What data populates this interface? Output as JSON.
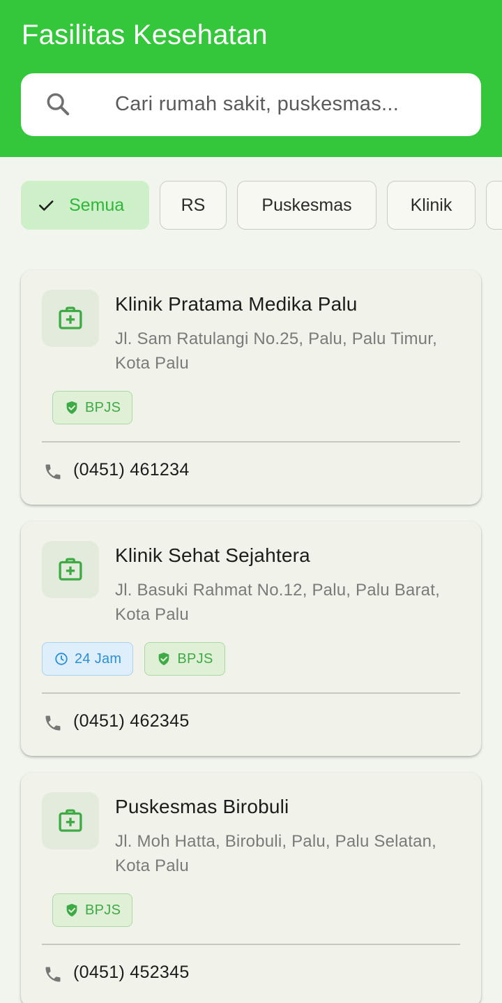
{
  "header": {
    "title": "Fasilitas Kesehatan",
    "search_placeholder": "Cari rumah sakit, puskesmas...",
    "search_value": ""
  },
  "filters": [
    {
      "label": "Semua",
      "active": true
    },
    {
      "label": "RS",
      "active": false
    },
    {
      "label": "Puskesmas",
      "active": false
    },
    {
      "label": "Klinik",
      "active": false
    }
  ],
  "facilities": [
    {
      "name": "Klinik Pratama Medika Palu",
      "address_line1": "Jl. Sam Ratulangi No.25, Palu, Palu Timur,",
      "address_line2": "Kota Palu",
      "badges": [
        "BPJS"
      ],
      "phone": "(0451) 461234"
    },
    {
      "name": "Klinik Sehat Sejahtera",
      "address_line1": "Jl. Basuki Rahmat No.12, Palu, Palu Barat,",
      "address_line2": "Kota Palu",
      "badges": [
        "24 Jam",
        "BPJS"
      ],
      "phone": "(0451) 462345"
    },
    {
      "name": "Puskesmas Birobuli",
      "address_line1": "Jl. Moh Hatta, Birobuli, Palu, Palu Selatan,",
      "address_line2": "Kota Palu",
      "badges": [
        "BPJS"
      ],
      "phone": "(0451) 452345"
    }
  ],
  "colors": {
    "primary": "#34c73b",
    "chip_active_bg": "#cdf0c9",
    "bpjs_green": "#3eaa45",
    "badge_24_blue": "#2a8fd8"
  },
  "icons": {
    "search": "search-icon",
    "check": "check-icon",
    "facility": "medical-bag-icon",
    "bpjs": "shield-check-icon",
    "hours": "clock-icon",
    "phone": "phone-icon"
  }
}
